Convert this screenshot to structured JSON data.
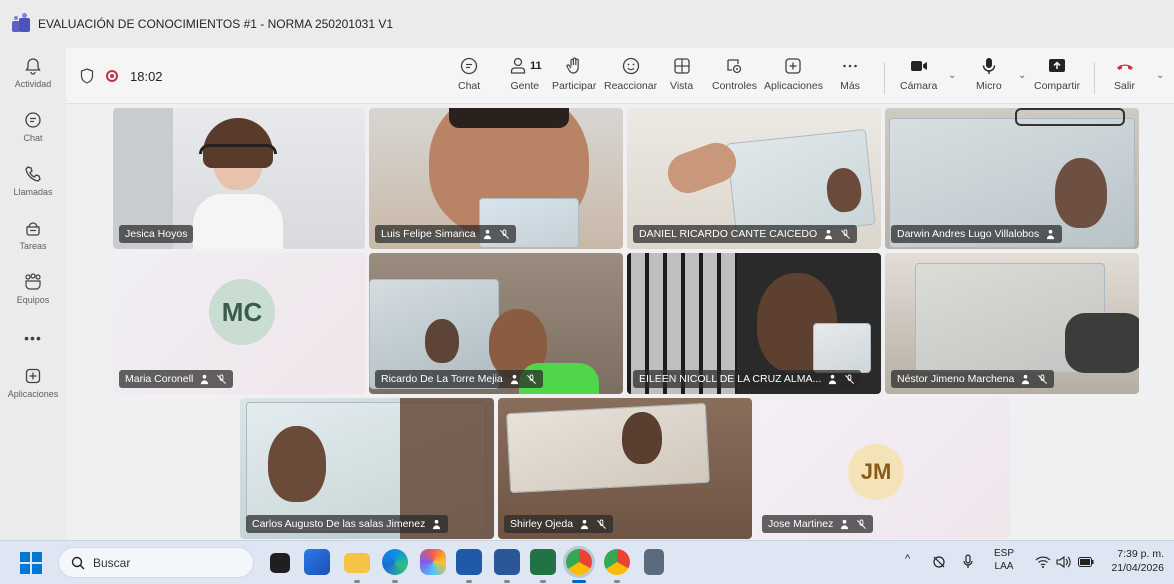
{
  "window": {
    "title": "EVALUACIÓN DE CONOCIMIENTOS #1 - NORMA 250201031 V1"
  },
  "rail": {
    "items": [
      {
        "label": "Actividad",
        "icon": "bell-icon"
      },
      {
        "label": "Chat",
        "icon": "chat-icon"
      },
      {
        "label": "Llamadas",
        "icon": "phone-icon"
      },
      {
        "label": "Tareas",
        "icon": "tasks-icon"
      },
      {
        "label": "Equipos",
        "icon": "teams-icon"
      },
      {
        "label": "Aplicaciones",
        "icon": "add-apps-icon"
      }
    ],
    "more": "•••"
  },
  "meeting": {
    "timer": "18:02",
    "toolbar": {
      "chat": "Chat",
      "people": "Gente",
      "people_count": "11",
      "raise": "Participar",
      "react": "Reaccionar",
      "view": "Vista",
      "controls": "Controles",
      "apps": "Aplicaciones",
      "more": "Más",
      "camera": "Cámara",
      "mic": "Micro",
      "share": "Compartir",
      "leave": "Salir"
    }
  },
  "participants": [
    {
      "name": "Jesica Hoyos"
    },
    {
      "name": "Luis Felipe Simanca"
    },
    {
      "name": "DANIEL RICARDO CANTE CAICEDO"
    },
    {
      "name": "Darwin Andres Lugo Villalobos"
    },
    {
      "name": "Maria Coronell",
      "initials": "MC"
    },
    {
      "name": "Ricardo De La Torre Mejia"
    },
    {
      "name": "EILEEN NICOLL DE LA CRUZ ALMA..."
    },
    {
      "name": "Néstor Jimeno Marchena"
    },
    {
      "name": "Carlos Augusto De las salas Jimenez"
    },
    {
      "name": "Shirley Ojeda"
    },
    {
      "name": "Jose Martinez",
      "initials": "JM"
    }
  ],
  "taskbar": {
    "search_placeholder": "Buscar",
    "lang": "ESP",
    "lang2": "LAA",
    "time": "7:39 p. m.",
    "date": "21/04/2026"
  },
  "colors": {
    "teams_purple": "#5b5fc7",
    "leave_red": "#c4314b",
    "record_red": "#c4314b"
  }
}
